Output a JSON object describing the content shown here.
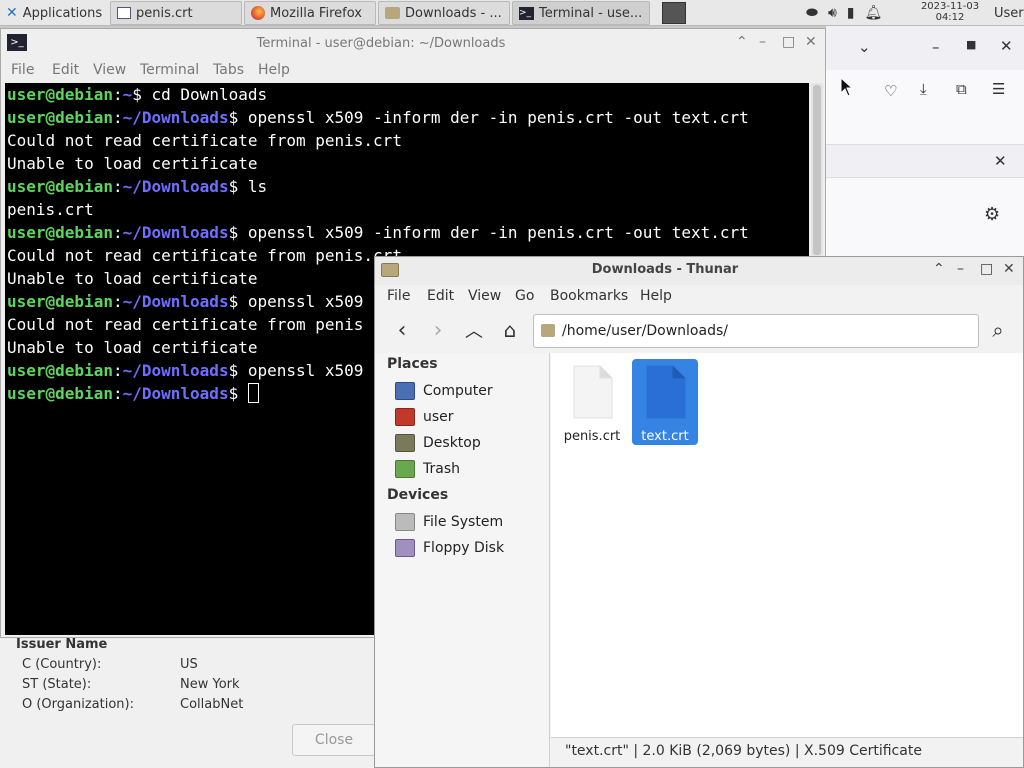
{
  "taskbar": {
    "apps_label": "Applications",
    "tasks": [
      {
        "label": "penis.crt"
      },
      {
        "label": "Mozilla Firefox"
      },
      {
        "label": "Downloads - ..."
      },
      {
        "label": "Terminal - use..."
      }
    ],
    "clock_date": "2023-11-03",
    "clock_time": "04:12",
    "user": "User"
  },
  "terminal": {
    "title": "Terminal - user@debian: ~/Downloads",
    "menu": [
      "File",
      "Edit",
      "View",
      "Terminal",
      "Tabs",
      "Help"
    ],
    "prompt_user": "user@debian",
    "lines": [
      {
        "type": "prompt",
        "path": "~",
        "cmd": "cd Downloads"
      },
      {
        "type": "prompt",
        "path": "~/Downloads",
        "cmd": "openssl x509 -inform der -in penis.crt -out text.crt"
      },
      {
        "type": "out",
        "text": "Could not read certificate from penis.crt"
      },
      {
        "type": "out",
        "text": "Unable to load certificate"
      },
      {
        "type": "prompt",
        "path": "~/Downloads",
        "cmd": "ls"
      },
      {
        "type": "out",
        "text": "penis.crt"
      },
      {
        "type": "prompt",
        "path": "~/Downloads",
        "cmd": "openssl x509 -inform der -in penis.crt -out text.crt"
      },
      {
        "type": "out",
        "text": "Could not read certificate from penis.crt"
      },
      {
        "type": "out",
        "text": "Unable to load certificate"
      },
      {
        "type": "prompt",
        "path": "~/Downloads",
        "cmd": "openssl x509"
      },
      {
        "type": "out",
        "text": "Could not read certificate from penis"
      },
      {
        "type": "out",
        "text": "Unable to load certificate"
      },
      {
        "type": "prompt",
        "path": "~/Downloads",
        "cmd": "openssl x509"
      },
      {
        "type": "prompt",
        "path": "~/Downloads",
        "cmd": "",
        "cursor": true
      }
    ]
  },
  "cert_viewer": {
    "section": "Issuer Name",
    "rows": [
      {
        "label": "C (Country):",
        "value": "US"
      },
      {
        "label": "ST (State):",
        "value": "New York"
      },
      {
        "label": "O (Organization):",
        "value": "CollabNet"
      }
    ],
    "close_label": "Close"
  },
  "thunar": {
    "title": "Downloads - Thunar",
    "menu": [
      "File",
      "Edit",
      "View",
      "Go",
      "Bookmarks",
      "Help"
    ],
    "location": "/home/user/Downloads/",
    "places_heading": "Places",
    "places": [
      {
        "label": "Computer",
        "icon": "computer-icon",
        "color": "#4a6fb5"
      },
      {
        "label": "user",
        "icon": "home-icon",
        "color": "#c0392b"
      },
      {
        "label": "Desktop",
        "icon": "desktop-icon",
        "color": "#7a7a5a"
      },
      {
        "label": "Trash",
        "icon": "trash-icon",
        "color": "#6aa84f"
      }
    ],
    "devices_heading": "Devices",
    "devices": [
      {
        "label": "File System",
        "icon": "drive-icon",
        "color": "#bbbbbb"
      },
      {
        "label": "Floppy Disk",
        "icon": "floppy-icon",
        "color": "#a090c0"
      }
    ],
    "files": [
      {
        "name": "penis.crt",
        "selected": false
      },
      {
        "name": "text.crt",
        "selected": true
      }
    ],
    "status": "\"text.crt\"  |  2.0 KiB (2,069 bytes)  |  X.509 Certificate",
    "selection_color": "#3584e4"
  }
}
